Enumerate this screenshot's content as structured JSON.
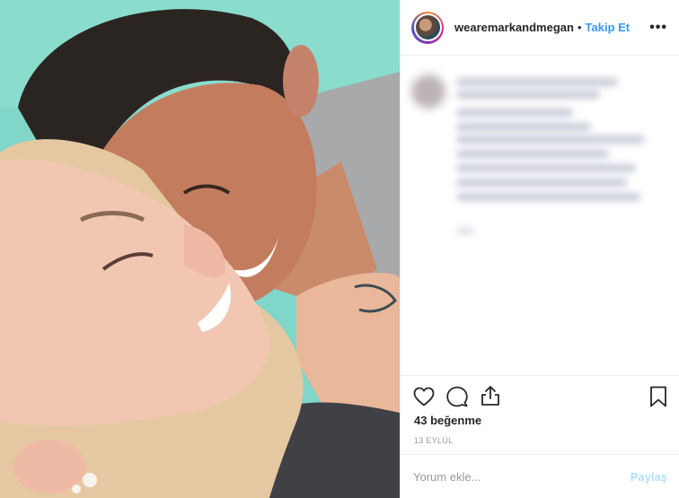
{
  "header": {
    "username": "wearemarkandmegan",
    "separator": "•",
    "follow_label": "Takip Et",
    "more_icon": "more-options-icon",
    "more_glyph": "•••"
  },
  "photo": {
    "description_icon": "post-photo"
  },
  "actions": {
    "like_icon": "heart-icon",
    "comment_icon": "comment-bubble-icon",
    "share_icon": "share-icon",
    "save_icon": "bookmark-icon"
  },
  "stats": {
    "likes_text": "43 beğenme",
    "date_text": "13 EYLÜL"
  },
  "comment": {
    "placeholder": "Yorum ekle...",
    "submit_label": "Paylaş"
  },
  "colors": {
    "accent": "#3897f0",
    "disabled_accent": "#b2dffc",
    "text": "#262626",
    "muted": "#999999"
  }
}
